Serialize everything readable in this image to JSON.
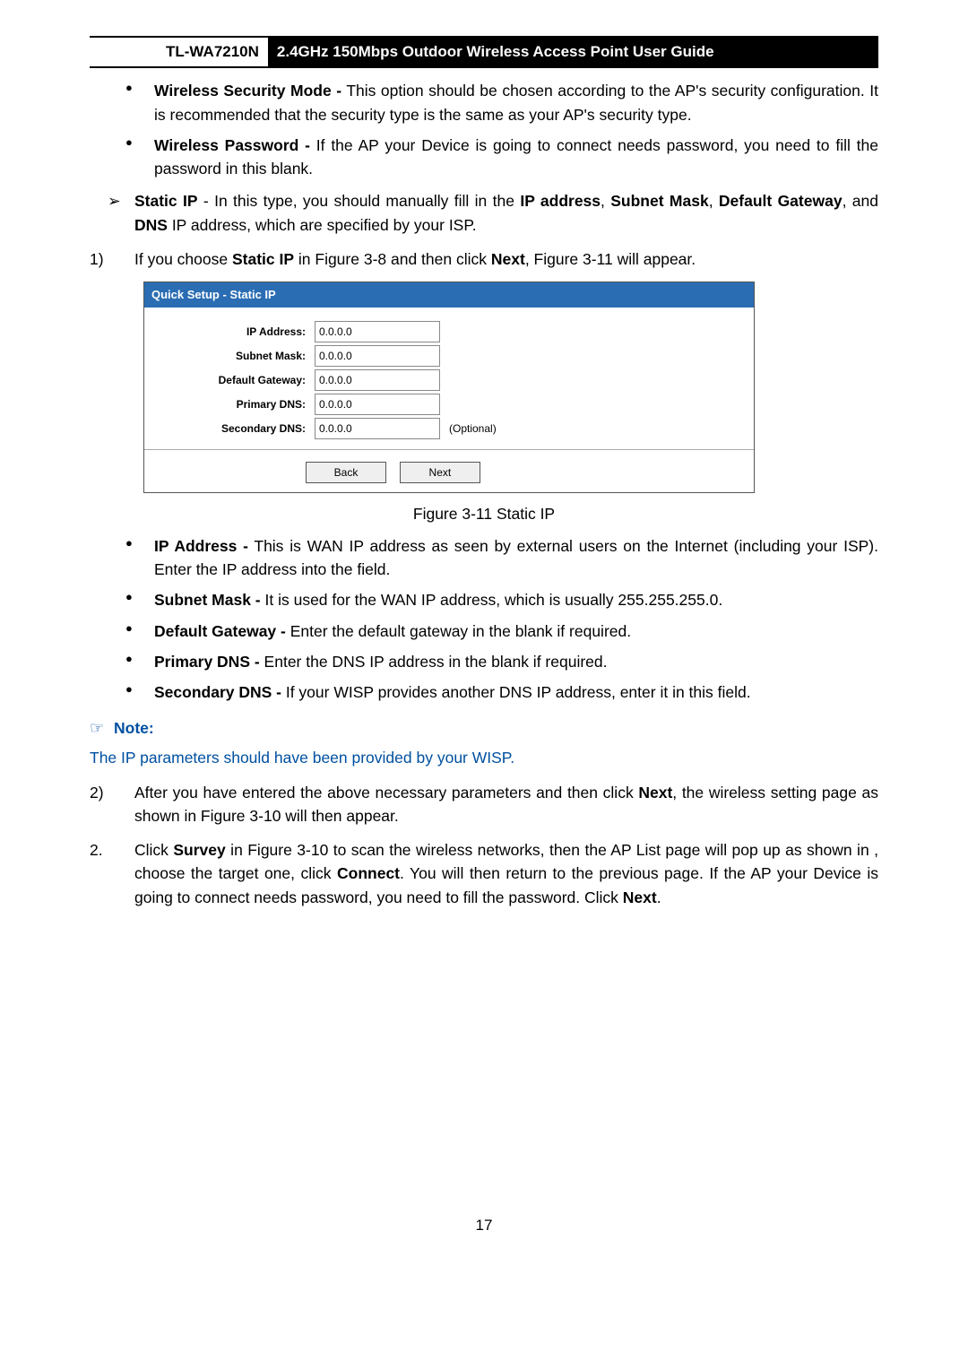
{
  "header": {
    "model": "TL-WA7210N",
    "title": "2.4GHz 150Mbps Outdoor Wireless Access Point User Guide"
  },
  "bullets1": [
    {
      "bold": "Wireless Security Mode -",
      "text": " This option should be chosen according to the AP's security configuration. It is recommended that the security type is the same as your AP's security type."
    },
    {
      "bold": "Wireless Password -",
      "text": " If the AP your Device is going to connect needs password, you need to fill the password in this blank."
    }
  ],
  "arrow": {
    "prefix": "Static IP",
    "mid": " - In this type, you should manually fill in the ",
    "b1": "IP address",
    "s1": ", ",
    "b2": "Subnet Mask",
    "s2": ", ",
    "b3": "Default Gateway",
    "s3": ", and ",
    "b4": "DNS",
    "tail": " IP address, which are specified by your ISP."
  },
  "num1": {
    "marker": "1)",
    "pre": "If you choose ",
    "b1": "Static IP",
    "mid": " in Figure 3-8 and then click ",
    "b2": "Next",
    "tail": ", Figure 3-11 will appear."
  },
  "figure": {
    "title": "Quick Setup - Static IP",
    "rows": [
      {
        "label": "IP Address:",
        "value": "0.0.0.0"
      },
      {
        "label": "Subnet Mask:",
        "value": "0.0.0.0"
      },
      {
        "label": "Default Gateway:",
        "value": "0.0.0.0"
      },
      {
        "label": "Primary DNS:",
        "value": "0.0.0.0"
      },
      {
        "label": "Secondary DNS:",
        "value": "0.0.0.0",
        "optional": "(Optional)"
      }
    ],
    "buttons": {
      "back": "Back",
      "next": "Next"
    }
  },
  "caption": "Figure 3-11 Static IP",
  "bullets2": [
    {
      "bold": "IP Address -",
      "text": " This is WAN IP address as seen by external users on the Internet (including your ISP). Enter the IP address into the field."
    },
    {
      "bold": "Subnet Mask -",
      "text": " It is used for the WAN IP address, which is usually 255.255.255.0."
    },
    {
      "bold": "Default Gateway -",
      "text": " Enter the default gateway in the blank if required."
    },
    {
      "bold": "Primary DNS -",
      "text": " Enter the DNS IP address in the blank if required."
    },
    {
      "bold": "Secondary DNS -",
      "text": " If your WISP provides another DNS IP address, enter it in this field."
    }
  ],
  "note": {
    "label": "Note:",
    "text": "The IP parameters should have been provided by your WISP."
  },
  "num2": {
    "marker": "2)",
    "pre": "After you have entered the above necessary parameters and then click ",
    "b1": "Next",
    "tail": ", the wireless setting page as shown in Figure 3-10 will then appear."
  },
  "num3": {
    "marker": "2.",
    "t1": "Click ",
    "b1": "Survey",
    "t2": " in Figure 3-10 to scan the wireless networks, then the AP List page will pop up as shown in , choose the target one, click ",
    "b2": "Connect",
    "t3": ". You will then return to the previous page. If the AP your Device is going to connect needs password, you need to fill the password. Click ",
    "b3": "Next",
    "t4": "."
  },
  "page_number": "17"
}
